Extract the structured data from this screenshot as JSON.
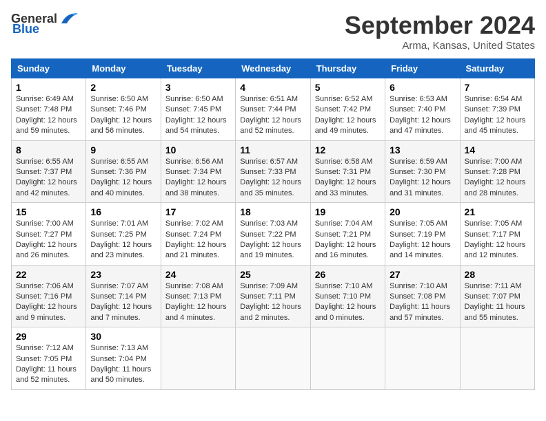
{
  "header": {
    "logo_general": "General",
    "logo_blue": "Blue",
    "month_title": "September 2024",
    "subtitle": "Arma, Kansas, United States"
  },
  "days_of_week": [
    "Sunday",
    "Monday",
    "Tuesday",
    "Wednesday",
    "Thursday",
    "Friday",
    "Saturday"
  ],
  "weeks": [
    [
      {
        "day": 1,
        "sunrise": "6:49 AM",
        "sunset": "7:48 PM",
        "daylight": "12 hours and 59 minutes."
      },
      {
        "day": 2,
        "sunrise": "6:50 AM",
        "sunset": "7:46 PM",
        "daylight": "12 hours and 56 minutes."
      },
      {
        "day": 3,
        "sunrise": "6:50 AM",
        "sunset": "7:45 PM",
        "daylight": "12 hours and 54 minutes."
      },
      {
        "day": 4,
        "sunrise": "6:51 AM",
        "sunset": "7:44 PM",
        "daylight": "12 hours and 52 minutes."
      },
      {
        "day": 5,
        "sunrise": "6:52 AM",
        "sunset": "7:42 PM",
        "daylight": "12 hours and 49 minutes."
      },
      {
        "day": 6,
        "sunrise": "6:53 AM",
        "sunset": "7:40 PM",
        "daylight": "12 hours and 47 minutes."
      },
      {
        "day": 7,
        "sunrise": "6:54 AM",
        "sunset": "7:39 PM",
        "daylight": "12 hours and 45 minutes."
      }
    ],
    [
      {
        "day": 8,
        "sunrise": "6:55 AM",
        "sunset": "7:37 PM",
        "daylight": "12 hours and 42 minutes."
      },
      {
        "day": 9,
        "sunrise": "6:55 AM",
        "sunset": "7:36 PM",
        "daylight": "12 hours and 40 minutes."
      },
      {
        "day": 10,
        "sunrise": "6:56 AM",
        "sunset": "7:34 PM",
        "daylight": "12 hours and 38 minutes."
      },
      {
        "day": 11,
        "sunrise": "6:57 AM",
        "sunset": "7:33 PM",
        "daylight": "12 hours and 35 minutes."
      },
      {
        "day": 12,
        "sunrise": "6:58 AM",
        "sunset": "7:31 PM",
        "daylight": "12 hours and 33 minutes."
      },
      {
        "day": 13,
        "sunrise": "6:59 AM",
        "sunset": "7:30 PM",
        "daylight": "12 hours and 31 minutes."
      },
      {
        "day": 14,
        "sunrise": "7:00 AM",
        "sunset": "7:28 PM",
        "daylight": "12 hours and 28 minutes."
      }
    ],
    [
      {
        "day": 15,
        "sunrise": "7:00 AM",
        "sunset": "7:27 PM",
        "daylight": "12 hours and 26 minutes."
      },
      {
        "day": 16,
        "sunrise": "7:01 AM",
        "sunset": "7:25 PM",
        "daylight": "12 hours and 23 minutes."
      },
      {
        "day": 17,
        "sunrise": "7:02 AM",
        "sunset": "7:24 PM",
        "daylight": "12 hours and 21 minutes."
      },
      {
        "day": 18,
        "sunrise": "7:03 AM",
        "sunset": "7:22 PM",
        "daylight": "12 hours and 19 minutes."
      },
      {
        "day": 19,
        "sunrise": "7:04 AM",
        "sunset": "7:21 PM",
        "daylight": "12 hours and 16 minutes."
      },
      {
        "day": 20,
        "sunrise": "7:05 AM",
        "sunset": "7:19 PM",
        "daylight": "12 hours and 14 minutes."
      },
      {
        "day": 21,
        "sunrise": "7:05 AM",
        "sunset": "7:17 PM",
        "daylight": "12 hours and 12 minutes."
      }
    ],
    [
      {
        "day": 22,
        "sunrise": "7:06 AM",
        "sunset": "7:16 PM",
        "daylight": "12 hours and 9 minutes."
      },
      {
        "day": 23,
        "sunrise": "7:07 AM",
        "sunset": "7:14 PM",
        "daylight": "12 hours and 7 minutes."
      },
      {
        "day": 24,
        "sunrise": "7:08 AM",
        "sunset": "7:13 PM",
        "daylight": "12 hours and 4 minutes."
      },
      {
        "day": 25,
        "sunrise": "7:09 AM",
        "sunset": "7:11 PM",
        "daylight": "12 hours and 2 minutes."
      },
      {
        "day": 26,
        "sunrise": "7:10 AM",
        "sunset": "7:10 PM",
        "daylight": "12 hours and 0 minutes."
      },
      {
        "day": 27,
        "sunrise": "7:10 AM",
        "sunset": "7:08 PM",
        "daylight": "11 hours and 57 minutes."
      },
      {
        "day": 28,
        "sunrise": "7:11 AM",
        "sunset": "7:07 PM",
        "daylight": "11 hours and 55 minutes."
      }
    ],
    [
      {
        "day": 29,
        "sunrise": "7:12 AM",
        "sunset": "7:05 PM",
        "daylight": "11 hours and 52 minutes."
      },
      {
        "day": 30,
        "sunrise": "7:13 AM",
        "sunset": "7:04 PM",
        "daylight": "11 hours and 50 minutes."
      },
      null,
      null,
      null,
      null,
      null
    ]
  ]
}
